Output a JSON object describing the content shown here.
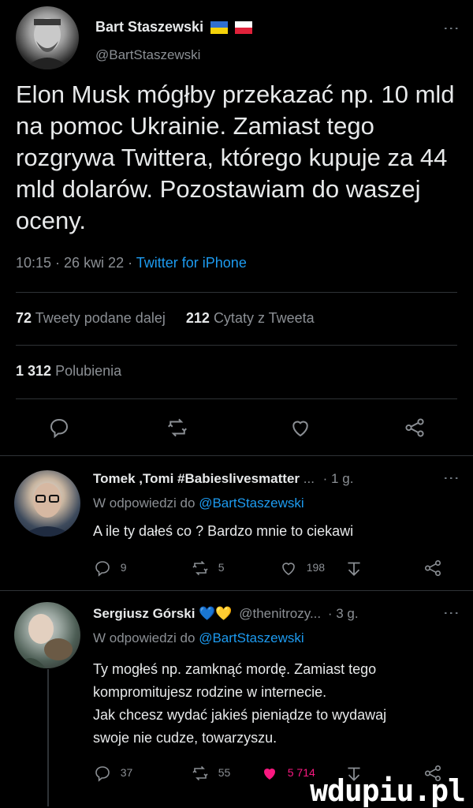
{
  "tweet": {
    "author_name": "Bart Staszewski",
    "author_handle": "@BartStaszewski",
    "text": "Elon Musk mógłby przekazać np. 10 mld na pomoc Ukrainie. Zamiast tego rozgrywa Twittera, którego kupuje za 44 mld dolarów. Pozostawiam do waszej oceny.",
    "time": "10:15 · 26 kwi 22 · ",
    "source": "Twitter for iPhone",
    "retweets_count": "72",
    "retweets_label": "Tweety podane dalej",
    "quotes_count": "212",
    "quotes_label": "Cytaty z Tweeta",
    "likes_count": "1 312",
    "likes_label": "Polubienia",
    "icons": [
      "reply-icon",
      "retweet-icon",
      "like-icon",
      "share-icon"
    ]
  },
  "replies": [
    {
      "name": "Tomek ,Tomi #Babieslivesmatter",
      "ellipsis": "...",
      "time": "· 1 g.",
      "replying_prefix": "W odpowiedzi do ",
      "replying_to": "@BartStaszewski",
      "text": "A ile ty dałeś co ? Bardzo mnie to ciekawi",
      "reply_count": "9",
      "retweet_count": "5",
      "like_count": "198"
    },
    {
      "name": "Sergiusz Górski",
      "hearts": "💙💛",
      "handle": "@thenitrozy...",
      "time": "· 3 g.",
      "replying_prefix": "W odpowiedzi do ",
      "replying_to": "@BartStaszewski",
      "text_lines": [
        "Ty mogłeś np. zamknąć mordę. Zamiast tego",
        "kompromitujesz rodzine w internecie.",
        "Jak chcesz wydać jakieś pieniądze to wydawaj",
        "swoje nie cudze, towarzyszu."
      ],
      "reply_count": "37",
      "retweet_count": "55",
      "like_count": "5 714"
    }
  ],
  "watermark": "wdupiu.pl",
  "colors": {
    "link": "#1d9bf0",
    "liked": "#f91880",
    "background": "#000000"
  }
}
